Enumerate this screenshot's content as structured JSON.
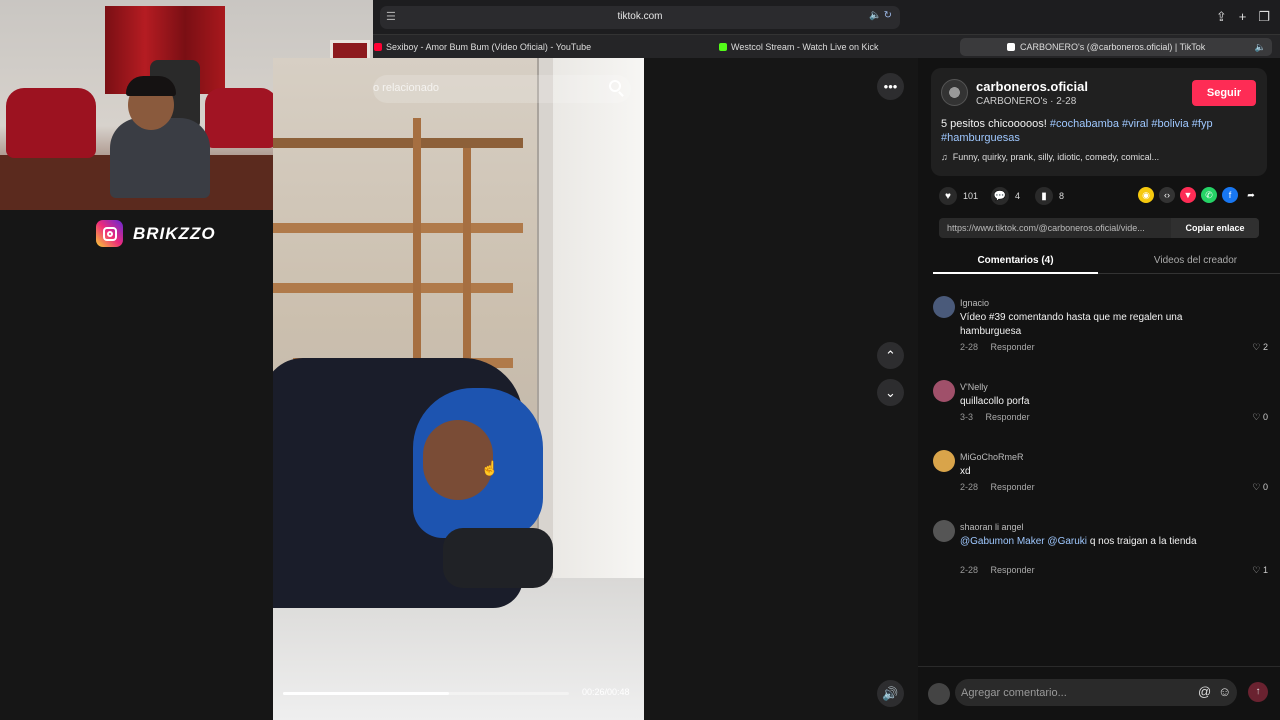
{
  "browser": {
    "url": "tiktok.com",
    "tabs": [
      {
        "label": "Sexiboy - Amor Bum Bum (Video Oficial) - YouTube",
        "favicon_color": "#ff0033"
      },
      {
        "label": "Westcol Stream - Watch Live on Kick",
        "favicon_color": "#53fc18"
      },
      {
        "label": "CARBONERO's (@carboneros.oficial) | TikTok",
        "favicon_color": "#ffffff"
      }
    ]
  },
  "overlay": {
    "instagram_handle": "BRIKZZO"
  },
  "video": {
    "search_placeholder": "o relacionado",
    "time": "00:26/00:48",
    "progress": 0.58
  },
  "post": {
    "account_name": "carboneros.oficial",
    "account_sub": "CARBONERO's · 2-28",
    "follow_label": "Seguir",
    "desc_text": "5 pesitos chicooooos!",
    "hashtags": [
      "#cochabamba",
      "#viral",
      "#bolivia",
      "#fyp",
      "#hamburguesas"
    ],
    "music": "Funny, quirky, prank, silly, idiotic, comedy, comical...",
    "likes": "101",
    "comments": "4",
    "saves": "8",
    "link_url": "https://www.tiktok.com/@carboneros.oficial/vide...",
    "copy_label": "Copiar enlace",
    "accent_color": "#fe2c55"
  },
  "tabs": {
    "comments": "Comentarios (4)",
    "creator_videos": "Videos del creador"
  },
  "comments": [
    {
      "user": "Ignacio",
      "text": "Vídeo #39 comentando hasta que me regalen una hamburguesa",
      "date": "2-28",
      "reply": "Responder",
      "likes": "2"
    },
    {
      "user": "V'Nelly",
      "text": "quillacollo porfa",
      "date": "3-3",
      "reply": "Responder",
      "likes": "0"
    },
    {
      "user": "MiGoChoRmeR",
      "text": "xd",
      "date": "2-28",
      "reply": "Responder",
      "likes": "0"
    },
    {
      "user": "shaoran li angel",
      "mentions": [
        "@Gabumon Maker",
        "@Garuki"
      ],
      "text": "q nos traigan a la tienda",
      "date": "2-28",
      "reply": "Responder",
      "likes": "1"
    }
  ],
  "comment_input": {
    "placeholder": "Agregar comentario..."
  }
}
